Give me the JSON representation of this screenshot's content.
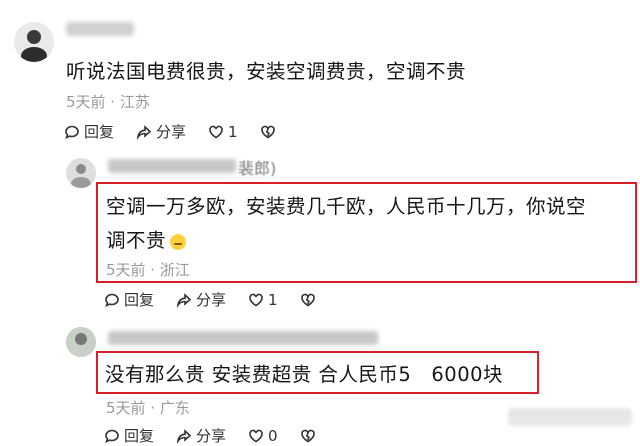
{
  "comments": [
    {
      "text": "听说法国电费很贵，安装空调费贵，空调不贵",
      "meta": "5天前 · 江苏",
      "reply": "回复",
      "share": "分享",
      "likes": "1"
    },
    {
      "name_suffix": "裴郎)",
      "text_line1": "空调一万多欧，安装费几千欧，人民币十几万，你说空",
      "text_line2": "调不贵",
      "meta": "5天前 · 浙江",
      "reply": "回复",
      "share": "分享",
      "likes": "1"
    },
    {
      "text": "没有那么贵 安装费超贵 合人民币5   6000块",
      "meta": "5天前 · 广东",
      "reply": "回复",
      "share": "分享",
      "likes": "0"
    }
  ],
  "colors": {
    "highlight": "#d6202a",
    "meta_text": "#9a9a9a"
  },
  "icons": [
    "reply-icon",
    "share-icon",
    "like-heart-icon",
    "dislike-heart-icon",
    "emoji-icon"
  ]
}
